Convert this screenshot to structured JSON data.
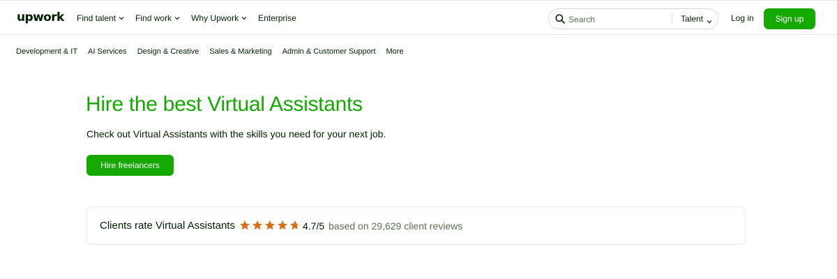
{
  "brand": {
    "logo_text": "upwork",
    "accent_color": "#14a800"
  },
  "top_nav": {
    "items": [
      {
        "label": "Find talent",
        "has_dropdown": true
      },
      {
        "label": "Find work",
        "has_dropdown": true
      },
      {
        "label": "Why Upwork",
        "has_dropdown": true
      },
      {
        "label": "Enterprise",
        "has_dropdown": false
      }
    ]
  },
  "search": {
    "placeholder": "Search",
    "value": "",
    "scope": "Talent",
    "icon": "search-icon"
  },
  "auth": {
    "login_label": "Log in",
    "signup_label": "Sign up"
  },
  "category_nav": {
    "items": [
      "Development & IT",
      "AI Services",
      "Design & Creative",
      "Sales & Marketing",
      "Admin & Customer Support",
      "More"
    ]
  },
  "hero": {
    "title": "Hire the best Virtual Assistants",
    "subtitle": "Check out Virtual Assistants with the skills you need for your next job.",
    "cta_label": "Hire freelancers"
  },
  "rating": {
    "label": "Clients rate Virtual Assistants",
    "stars": 4.7,
    "max_stars": 5,
    "star_color": "#d4731f",
    "score_text": "4.7/5",
    "reviews_text": "based on 29,629 client reviews"
  }
}
